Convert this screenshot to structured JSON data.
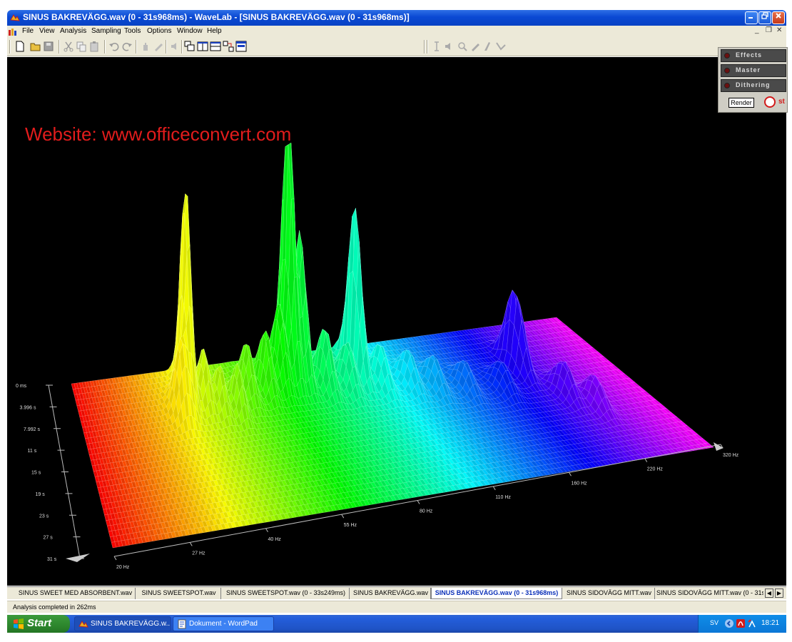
{
  "window": {
    "title": "SINUS BAKREVÄGG.wav (0 - 31s968ms) - WaveLab - [SINUS BAKREVÄGG.wav (0 - 31s968ms)]",
    "controls": [
      "minimize",
      "maximize",
      "close"
    ]
  },
  "menu": {
    "items": [
      "File",
      "View",
      "Analysis",
      "Sampling",
      "Tools",
      "Options",
      "Window",
      "Help"
    ]
  },
  "watermark": "Website: www.officeconvert.com",
  "master_section": {
    "rows": [
      "Effects",
      "Master",
      "Dithering"
    ],
    "render_label": "Render",
    "stop_label": "st"
  },
  "plot_3d": {
    "time_labels": [
      "0 ms",
      "3.996 s",
      "7.992 s",
      "11 s",
      "15 s",
      "19 s",
      "23 s",
      "27 s",
      "31 s"
    ],
    "freq_labels": [
      "20 Hz",
      "27 Hz",
      "40 Hz",
      "55 Hz",
      "80 Hz",
      "110 Hz",
      "160 Hz",
      "220 Hz",
      "320 Hz"
    ]
  },
  "doc_tabs": [
    {
      "label": "SINUS SWEET MED ABSORBENT.wav",
      "active": false
    },
    {
      "label": "SINUS SWEETSPOT.wav",
      "active": false
    },
    {
      "label": "SINUS SWEETSPOT.wav (0 - 33s249ms)",
      "active": false
    },
    {
      "label": "SINUS BAKREVÄGG.wav",
      "active": false
    },
    {
      "label": "SINUS BAKREVÄGG.wav (0 - 31s968ms)",
      "active": true
    },
    {
      "label": "SINUS SIDOVÄGG MITT.wav",
      "active": false
    },
    {
      "label": "SINUS SIDOVÄGG MITT.wav (0 - 31s",
      "active": false
    }
  ],
  "status": "Analysis completed in 262ms",
  "taskbar": {
    "start_label": "Start",
    "tasks": [
      {
        "label": "SINUS BAKREVÄGG.w...",
        "pressed": true
      },
      {
        "label": "Dokument - WordPad",
        "pressed": false
      }
    ],
    "tray_lang": "SV",
    "clock": "18:21"
  },
  "colors": {
    "title_bar": "#0a49d3",
    "watermark": "#e21c1c",
    "plot_background": "#000000",
    "active_tab_text": "#0a2fb8",
    "start_button": "#2f8a2f"
  }
}
